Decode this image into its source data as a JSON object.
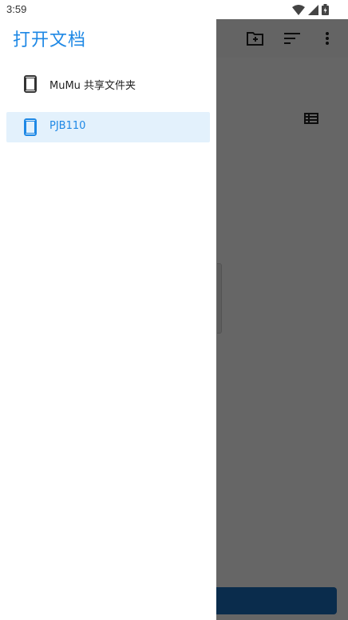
{
  "status_bar": {
    "time": "3:59",
    "icons": [
      "wifi-icon",
      "signal-icon",
      "battery-icon"
    ]
  },
  "drawer": {
    "title": "打开文档",
    "roots": [
      {
        "label": "MuMu 共享文件夹",
        "icon": "phone-icon",
        "selected": false
      },
      {
        "label": "PJB110",
        "icon": "phone-icon",
        "selected": true
      }
    ]
  },
  "background_app": {
    "toolbar_icons": [
      "new-folder-icon",
      "sort-icon",
      "more-vert-icon"
    ],
    "view_toggle_icon": "list-view-icon"
  },
  "colors": {
    "accent": "#1e88e5",
    "selected_bg": "#e3f1fc",
    "scrim": "rgba(0,0,0,0.6)"
  }
}
